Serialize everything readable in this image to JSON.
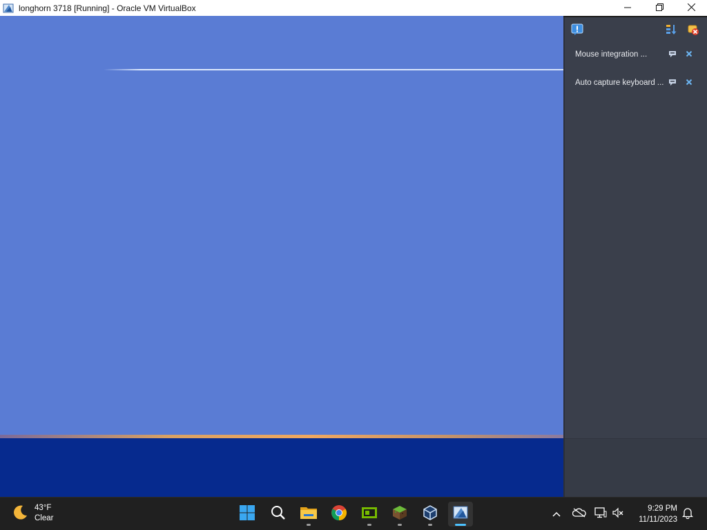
{
  "window": {
    "title": "longhorn 3718 [Running] - Oracle VM VirtualBox",
    "icons": [
      "virtualbox-vm-icon",
      "minimize-icon",
      "restore-icon",
      "close-icon"
    ]
  },
  "notification_center": {
    "toolbar_icons": [
      "notification-center-icon",
      "sort-order-icon",
      "clear-all-icon"
    ],
    "items": [
      {
        "text": "Mouse integration ...",
        "icons": [
          "keep-icon",
          "close-icon"
        ]
      },
      {
        "text": "Auto capture keyboard ...",
        "icons": [
          "keep-icon",
          "close-icon"
        ]
      }
    ]
  },
  "taskbar": {
    "weather": {
      "temp": "43°F",
      "condition": "Clear",
      "icon": "moon-icon"
    },
    "apps": [
      "start-icon",
      "search-icon",
      "file-explorer-icon",
      "chrome-icon",
      "nvidia-icon",
      "minecraft-icon",
      "virtualbox-manager-icon",
      "virtualbox-vm-icon"
    ],
    "tray_icons": [
      "chevron-up-icon",
      "onedrive-offline-icon",
      "network-icon",
      "volume-muted-icon",
      "bell-icon"
    ],
    "clock": {
      "time": "9:29 PM",
      "date": "11/11/2023"
    }
  },
  "colors": {
    "vm_desktop": "#5a7cd4",
    "vm_taskbar": "#062a8e",
    "panel_bg": "#3a3f4b",
    "host_taskbar": "#202020",
    "accent": "#4cc2ff"
  }
}
